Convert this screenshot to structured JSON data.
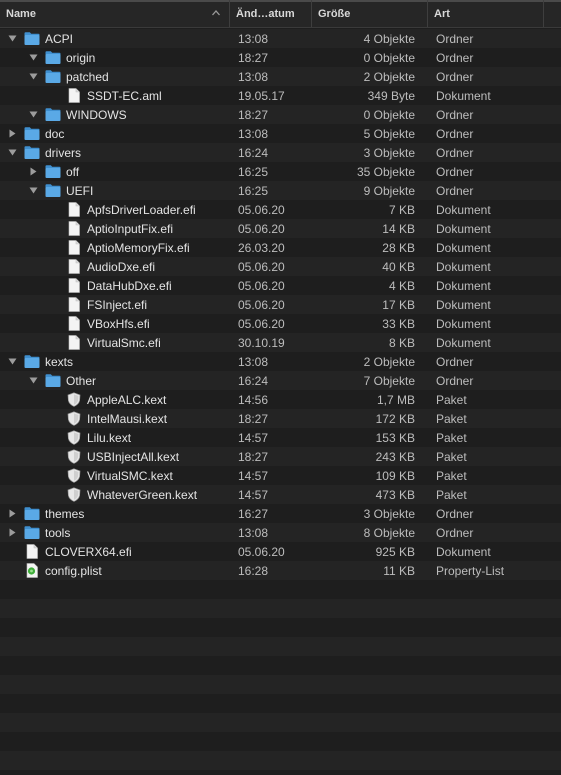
{
  "columns": {
    "name": "Name",
    "date": "Änd…atum",
    "size": "Größe",
    "kind": "Art"
  },
  "colors": {
    "folder": "#5aa9e6",
    "folder_dark": "#3f8fcf",
    "background": "#1e1e1e",
    "stripe": "#242424",
    "plist_green": "#3fae3a"
  },
  "rows": [
    {
      "name": "ACPI",
      "date": "13:08",
      "size": "4 Objekte",
      "kind": "Ordner",
      "icon": "folder-icon",
      "depth": 0,
      "disclosure": "open"
    },
    {
      "name": "origin",
      "date": "18:27",
      "size": "0 Objekte",
      "kind": "Ordner",
      "icon": "folder-icon",
      "depth": 1,
      "disclosure": "open"
    },
    {
      "name": "patched",
      "date": "13:08",
      "size": "2 Objekte",
      "kind": "Ordner",
      "icon": "folder-icon",
      "depth": 1,
      "disclosure": "open"
    },
    {
      "name": "SSDT-EC.aml",
      "date": "19.05.17",
      "size": "349 Byte",
      "kind": "Dokument",
      "icon": "document-icon",
      "depth": 2,
      "disclosure": "none"
    },
    {
      "name": "WINDOWS",
      "date": "18:27",
      "size": "0 Objekte",
      "kind": "Ordner",
      "icon": "folder-icon",
      "depth": 1,
      "disclosure": "open"
    },
    {
      "name": "doc",
      "date": "13:08",
      "size": "5 Objekte",
      "kind": "Ordner",
      "icon": "folder-icon",
      "depth": 0,
      "disclosure": "closed"
    },
    {
      "name": "drivers",
      "date": "16:24",
      "size": "3 Objekte",
      "kind": "Ordner",
      "icon": "folder-icon",
      "depth": 0,
      "disclosure": "open"
    },
    {
      "name": "off",
      "date": "16:25",
      "size": "35 Objekte",
      "kind": "Ordner",
      "icon": "folder-icon",
      "depth": 1,
      "disclosure": "closed"
    },
    {
      "name": "UEFI",
      "date": "16:25",
      "size": "9 Objekte",
      "kind": "Ordner",
      "icon": "folder-icon",
      "depth": 1,
      "disclosure": "open"
    },
    {
      "name": "ApfsDriverLoader.efi",
      "date": "05.06.20",
      "size": "7 KB",
      "kind": "Dokument",
      "icon": "document-icon",
      "depth": 2,
      "disclosure": "none"
    },
    {
      "name": "AptioInputFix.efi",
      "date": "05.06.20",
      "size": "14 KB",
      "kind": "Dokument",
      "icon": "document-icon",
      "depth": 2,
      "disclosure": "none"
    },
    {
      "name": "AptioMemoryFix.efi",
      "date": "26.03.20",
      "size": "28 KB",
      "kind": "Dokument",
      "icon": "document-icon",
      "depth": 2,
      "disclosure": "none"
    },
    {
      "name": "AudioDxe.efi",
      "date": "05.06.20",
      "size": "40 KB",
      "kind": "Dokument",
      "icon": "document-icon",
      "depth": 2,
      "disclosure": "none"
    },
    {
      "name": "DataHubDxe.efi",
      "date": "05.06.20",
      "size": "4 KB",
      "kind": "Dokument",
      "icon": "document-icon",
      "depth": 2,
      "disclosure": "none"
    },
    {
      "name": "FSInject.efi",
      "date": "05.06.20",
      "size": "17 KB",
      "kind": "Dokument",
      "icon": "document-icon",
      "depth": 2,
      "disclosure": "none"
    },
    {
      "name": "VBoxHfs.efi",
      "date": "05.06.20",
      "size": "33 KB",
      "kind": "Dokument",
      "icon": "document-icon",
      "depth": 2,
      "disclosure": "none"
    },
    {
      "name": "VirtualSmc.efi",
      "date": "30.10.19",
      "size": "8 KB",
      "kind": "Dokument",
      "icon": "document-icon",
      "depth": 2,
      "disclosure": "none"
    },
    {
      "name": "kexts",
      "date": "13:08",
      "size": "2 Objekte",
      "kind": "Ordner",
      "icon": "folder-icon",
      "depth": 0,
      "disclosure": "open"
    },
    {
      "name": "Other",
      "date": "16:24",
      "size": "7 Objekte",
      "kind": "Ordner",
      "icon": "folder-icon",
      "depth": 1,
      "disclosure": "open"
    },
    {
      "name": "AppleALC.kext",
      "date": "14:56",
      "size": "1,7 MB",
      "kind": "Paket",
      "icon": "kext-shield-icon",
      "depth": 2,
      "disclosure": "none"
    },
    {
      "name": "IntelMausi.kext",
      "date": "18:27",
      "size": "172 KB",
      "kind": "Paket",
      "icon": "kext-shield-icon",
      "depth": 2,
      "disclosure": "none"
    },
    {
      "name": "Lilu.kext",
      "date": "14:57",
      "size": "153 KB",
      "kind": "Paket",
      "icon": "kext-shield-icon",
      "depth": 2,
      "disclosure": "none"
    },
    {
      "name": "USBInjectAll.kext",
      "date": "18:27",
      "size": "243 KB",
      "kind": "Paket",
      "icon": "kext-shield-icon",
      "depth": 2,
      "disclosure": "none"
    },
    {
      "name": "VirtualSMC.kext",
      "date": "14:57",
      "size": "109 KB",
      "kind": "Paket",
      "icon": "kext-shield-icon",
      "depth": 2,
      "disclosure": "none"
    },
    {
      "name": "WhateverGreen.kext",
      "date": "14:57",
      "size": "473 KB",
      "kind": "Paket",
      "icon": "kext-shield-icon",
      "depth": 2,
      "disclosure": "none"
    },
    {
      "name": "themes",
      "date": "16:27",
      "size": "3 Objekte",
      "kind": "Ordner",
      "icon": "folder-icon",
      "depth": 0,
      "disclosure": "closed"
    },
    {
      "name": "tools",
      "date": "13:08",
      "size": "8 Objekte",
      "kind": "Ordner",
      "icon": "folder-icon",
      "depth": 0,
      "disclosure": "closed"
    },
    {
      "name": "CLOVERX64.efi",
      "date": "05.06.20",
      "size": "925 KB",
      "kind": "Dokument",
      "icon": "document-icon",
      "depth": 0,
      "disclosure": "none"
    },
    {
      "name": "config.plist",
      "date": "16:28",
      "size": "11 KB",
      "kind": "Property-List",
      "icon": "plist-icon",
      "depth": 0,
      "disclosure": "none"
    }
  ]
}
